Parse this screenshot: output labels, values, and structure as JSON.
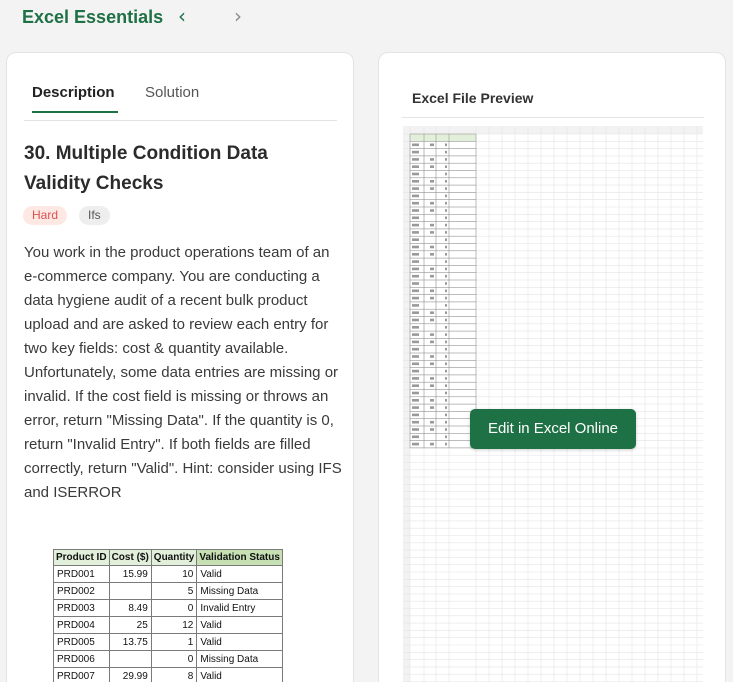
{
  "app": {
    "title": "Excel Essentials",
    "prev_icon": "chevron-left-icon",
    "next_icon": "chevron-right-icon",
    "prev_glyph": "‹",
    "next_glyph": "›"
  },
  "tabs": [
    {
      "label": "Description",
      "active": true
    },
    {
      "label": "Solution",
      "active": false
    }
  ],
  "question": {
    "title": "30. Multiple Condition Data Validity Checks",
    "difficulty": "Hard",
    "tag": "Ifs",
    "body": "You work in the product operations team of an e-commerce company. You are conducting a data hygiene audit of a recent bulk product upload and are asked to review each entry for two key fields: cost & quantity available. Unfortunately, some data entries are missing or invalid. If the cost field is missing or throws an error, return \"Missing Data\". If the quantity is 0, return \"Invalid Entry\". If both fields are filled correctly, return \"Valid\". Hint: consider using IFS and ISERROR"
  },
  "sample_table": {
    "headers": [
      "Product ID",
      "Cost ($)",
      "Quantity",
      "Validation Status"
    ],
    "rows": [
      [
        "PRD001",
        "15.99",
        "10",
        "Valid"
      ],
      [
        "PRD002",
        "",
        "5",
        "Missing Data"
      ],
      [
        "PRD003",
        "8.49",
        "0",
        "Invalid Entry"
      ],
      [
        "PRD004",
        "25",
        "12",
        "Valid"
      ],
      [
        "PRD005",
        "13.75",
        "1",
        "Valid"
      ],
      [
        "PRD006",
        "",
        "0",
        "Missing Data"
      ],
      [
        "PRD007",
        "29.99",
        "8",
        "Valid"
      ]
    ]
  },
  "preview": {
    "title": "Excel File Preview",
    "edit_button": "Edit in Excel Online"
  },
  "colors": {
    "accent": "#1e7145",
    "hard_badge_bg": "#fde8e4",
    "hard_badge_text": "#d9534f",
    "header_fill": "#e2efda"
  }
}
